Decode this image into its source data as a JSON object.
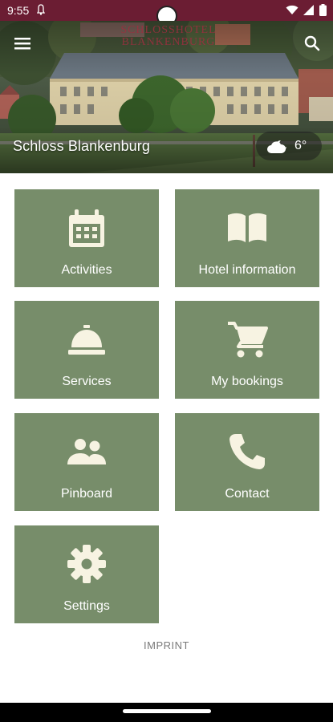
{
  "status_bar": {
    "time": "9:55",
    "bg_color": "#6b1d33",
    "icons": [
      "notification-icon",
      "wifi-icon",
      "cellular-icon",
      "battery-icon"
    ]
  },
  "hero": {
    "title": "Schloss Blankenburg",
    "logo_text": "SCHLOSSHOTEL BLANKENBURG",
    "weather_temp": "6°",
    "weather_icon": "cloudy-night-icon",
    "menu_icon": "hamburger-menu-icon",
    "search_icon": "search-icon"
  },
  "tiles": [
    {
      "label": "Activities",
      "icon": "calendar-icon"
    },
    {
      "label": "Hotel information",
      "icon": "open-book-icon"
    },
    {
      "label": "Services",
      "icon": "service-bell-icon"
    },
    {
      "label": "My bookings",
      "icon": "shopping-cart-icon"
    },
    {
      "label": "Pinboard",
      "icon": "people-icon"
    },
    {
      "label": "Contact",
      "icon": "phone-icon"
    },
    {
      "label": "Settings",
      "icon": "gear-icon"
    }
  ],
  "footer": {
    "imprint": "IMPRINT"
  },
  "colors": {
    "tile_bg": "#778d6a",
    "icon_color": "#f7f3e2",
    "brand": "#6b1d33"
  }
}
